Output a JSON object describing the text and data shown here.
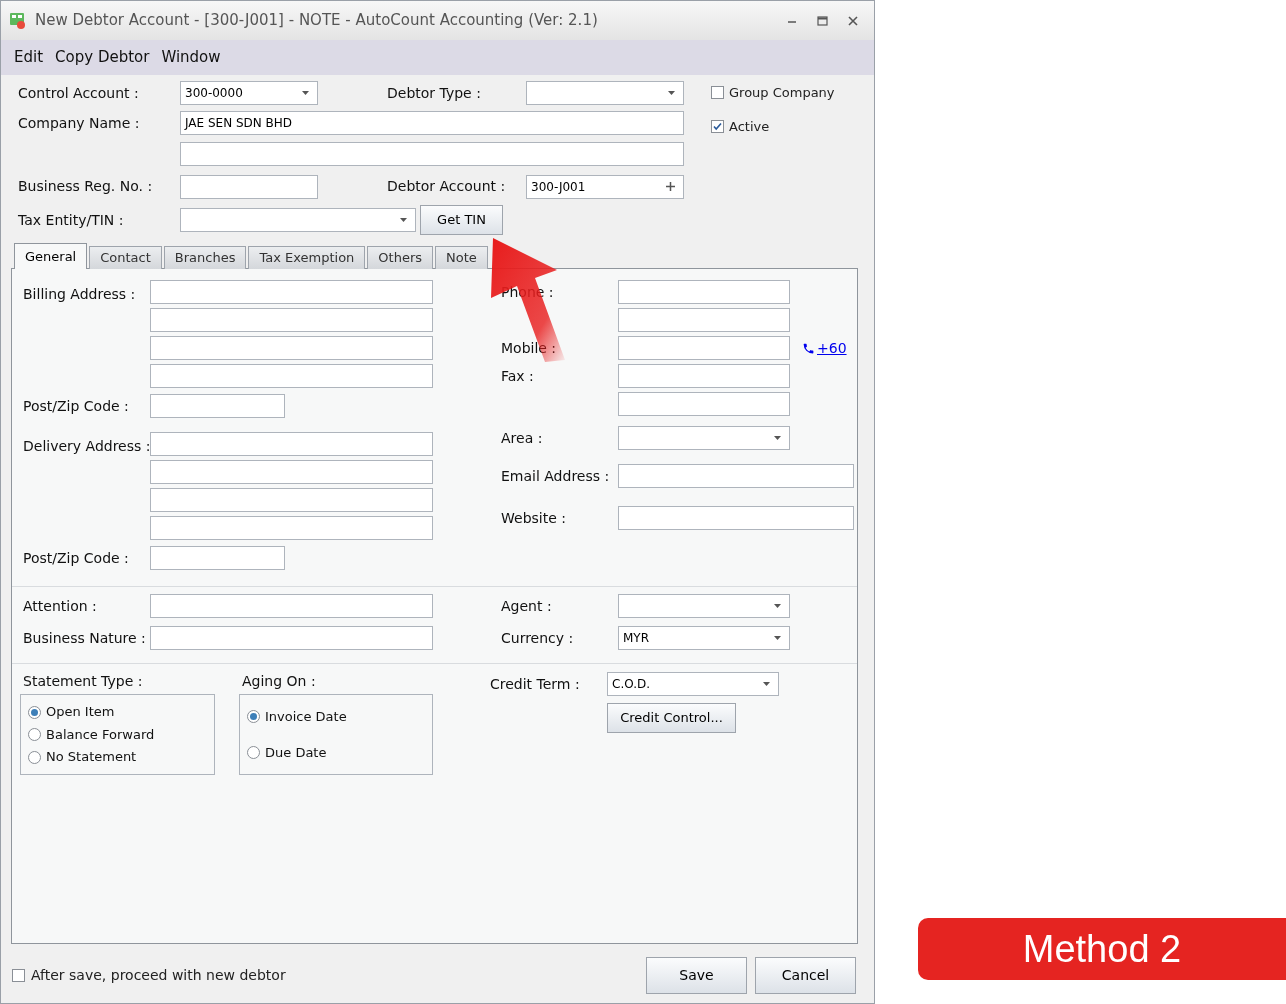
{
  "window": {
    "title": "New Debtor Account - [300-J001] - NOTE - AutoCount Accounting (Ver: 2.1)"
  },
  "menu": [
    {
      "label": "Edit"
    },
    {
      "label": "Copy Debtor"
    },
    {
      "label": "Window"
    }
  ],
  "header": {
    "control_account": {
      "label": "Control Account :",
      "value": "300-0000"
    },
    "debtor_type": {
      "label": "Debtor Type :"
    },
    "company_name": {
      "label": "Company Name :",
      "value": "JAE SEN SDN BHD"
    },
    "business_reg_no": {
      "label": "Business Reg. No. :"
    },
    "debtor_account": {
      "label": "Debtor Account :",
      "value": "300-J001"
    },
    "tax_entity": {
      "label": "Tax Entity/TIN :"
    },
    "get_tin_button": "Get TIN"
  },
  "checkboxes": [
    {
      "label": "Group Company",
      "checked": false
    },
    {
      "label": "Active",
      "checked": true
    }
  ],
  "tabs": [
    {
      "label": "General",
      "selected": true
    },
    {
      "label": "Contact",
      "selected": false
    },
    {
      "label": "Branches",
      "selected": false
    },
    {
      "label": "Tax Exemption",
      "selected": false
    },
    {
      "label": "Others",
      "selected": false
    },
    {
      "label": "Note",
      "selected": false
    }
  ],
  "billing_address": {
    "label": "Billing Address :",
    "postcode_label": "Post/Zip Code :"
  },
  "delivery_address": {
    "label": "Delivery Address :",
    "postcode_label": "Post/Zip Code :"
  },
  "contact_fields": [
    {
      "kind": "text",
      "label": "Phone :"
    },
    {
      "kind": "text"
    },
    {
      "kind": "text",
      "label": "Mobile :",
      "link": "+60"
    },
    {
      "kind": "text",
      "label": "Fax :"
    },
    {
      "kind": "text"
    },
    {
      "kind": "dropdown",
      "label": "Area :"
    },
    {
      "kind": "wide",
      "label": "Email  Address :"
    },
    {
      "kind": "wide",
      "label": "Website :"
    }
  ],
  "attention": {
    "label": "Attention :"
  },
  "business_nature": {
    "label": "Business Nature :"
  },
  "agent": {
    "label": "Agent :"
  },
  "currency": {
    "label": "Currency :",
    "value": "MYR"
  },
  "statement_type": {
    "label": "Statement Type :",
    "options": [
      {
        "label": "Open Item",
        "selected": true
      },
      {
        "label": "Balance Forward",
        "selected": false
      },
      {
        "label": "No Statement",
        "selected": false
      }
    ]
  },
  "aging_on": {
    "label": "Aging On :",
    "options": [
      {
        "label": "Invoice Date",
        "selected": true
      },
      {
        "label": "Due Date",
        "selected": false
      }
    ]
  },
  "credit_term": {
    "label": "Credit Term :",
    "value": "C.O.D."
  },
  "credit_control_button": "Credit Control...",
  "after_save": {
    "label": "After save, proceed with new debtor",
    "checked": false
  },
  "buttons": [
    "Save",
    "Cancel"
  ],
  "badge": "Method 2"
}
